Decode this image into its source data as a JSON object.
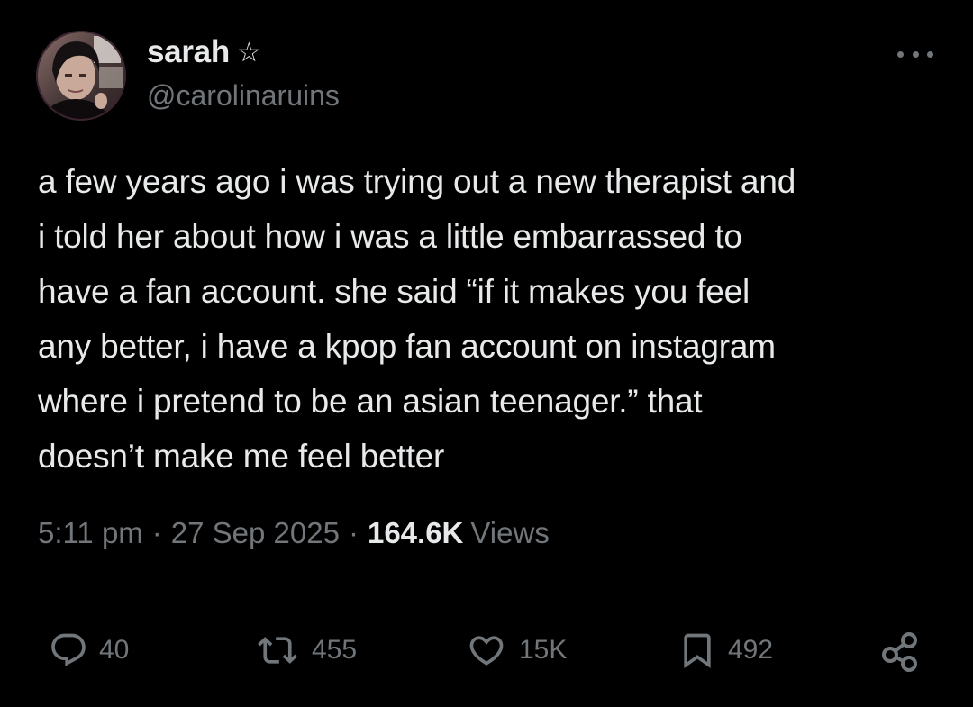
{
  "author": {
    "display_name": "sarah",
    "badge_icon": "star-icon",
    "handle": "@carolinaruins",
    "avatar_icon": "avatar-photo"
  },
  "tweet": {
    "text": "a few years ago i was trying out a new therapist and\ni told her about how i was a little embarrassed to\nhave a fan account. she said “if it makes you feel\nany better, i have a kpop fan account on instagram\nwhere i pretend to be an asian teenager.” that\ndoesn’t make me feel better"
  },
  "meta": {
    "time": "5:11 pm",
    "separator": "·",
    "date": "27 Sep 2025",
    "views_count": "164.6K",
    "views_label": "Views"
  },
  "actions": {
    "reply": {
      "icon": "reply-icon",
      "count": "40"
    },
    "retweet": {
      "icon": "retweet-icon",
      "count": "455"
    },
    "like": {
      "icon": "heart-icon",
      "count": "15K"
    },
    "bookmark": {
      "icon": "bookmark-icon",
      "count": "492"
    },
    "share": {
      "icon": "share-icon"
    }
  },
  "colors": {
    "background": "#000000",
    "text_primary": "#e7e9ea",
    "text_secondary": "#71767b",
    "divider": "#2f3336"
  }
}
